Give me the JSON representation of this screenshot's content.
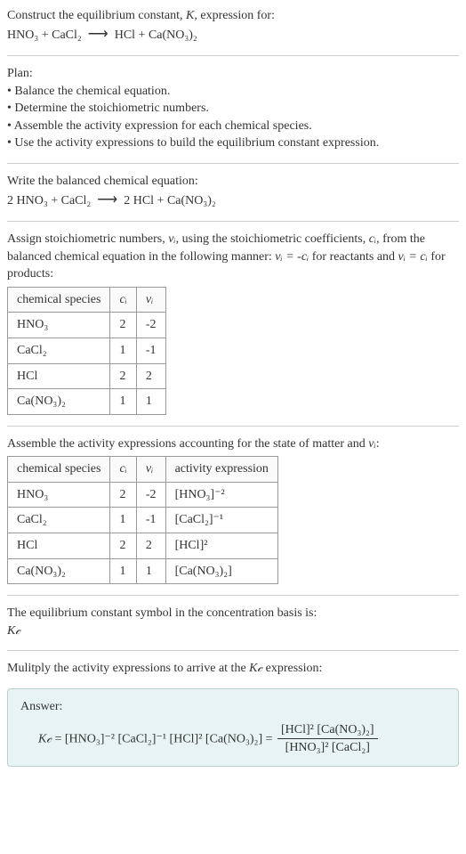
{
  "header": {
    "line1": "Construct the equilibrium constant, ",
    "k": "K",
    "line1b": ", expression for:",
    "eq_lhs": "HNO₃ + CaCl₂",
    "arrow": "⟶",
    "eq_rhs": "HCl + Ca(NO₃)₂"
  },
  "plan": {
    "title": "Plan:",
    "b1": "• Balance the chemical equation.",
    "b2": "• Determine the stoichiometric numbers.",
    "b3": "• Assemble the activity expression for each chemical species.",
    "b4": "• Use the activity expressions to build the equilibrium constant expression."
  },
  "balanced": {
    "title": "Write the balanced chemical equation:",
    "lhs": "2 HNO₃ + CaCl₂",
    "arrow": "⟶",
    "rhs": "2 HCl + Ca(NO₃)₂"
  },
  "stoich": {
    "intro1": "Assign stoichiometric numbers, ",
    "nu": "νᵢ",
    "intro2": ", using the stoichiometric coefficients, ",
    "ci": "cᵢ",
    "intro3": ", from the balanced chemical equation in the following manner: ",
    "rel_react": "νᵢ = -cᵢ",
    "intro4": " for reactants and ",
    "rel_prod": "νᵢ = cᵢ",
    "intro5": " for products:",
    "headers": [
      "chemical species",
      "cᵢ",
      "νᵢ"
    ],
    "rows": [
      [
        "HNO₃",
        "2",
        "-2"
      ],
      [
        "CaCl₂",
        "1",
        "-1"
      ],
      [
        "HCl",
        "2",
        "2"
      ],
      [
        "Ca(NO₃)₂",
        "1",
        "1"
      ]
    ]
  },
  "activity": {
    "intro": "Assemble the activity expressions accounting for the state of matter and ",
    "nu": "νᵢ",
    "colon": ":",
    "headers": [
      "chemical species",
      "cᵢ",
      "νᵢ",
      "activity expression"
    ],
    "rows": [
      [
        "HNO₃",
        "2",
        "-2",
        "[HNO₃]⁻²"
      ],
      [
        "CaCl₂",
        "1",
        "-1",
        "[CaCl₂]⁻¹"
      ],
      [
        "HCl",
        "2",
        "2",
        "[HCl]²"
      ],
      [
        "Ca(NO₃)₂",
        "1",
        "1",
        "[Ca(NO₃)₂]"
      ]
    ]
  },
  "kcdef": {
    "line1": "The equilibrium constant symbol in the concentration basis is:",
    "kc": "K𝒸"
  },
  "mult": {
    "line": "Mulitply the activity expressions to arrive at the ",
    "kc": "K𝒸",
    "line2": " expression:"
  },
  "answer": {
    "label": "Answer:",
    "kc": "K𝒸",
    "eq": " = [HNO₃]⁻² [CaCl₂]⁻¹ [HCl]² [Ca(NO₃)₂] = ",
    "num": "[HCl]² [Ca(NO₃)₂]",
    "den": "[HNO₃]² [CaCl₂]"
  }
}
